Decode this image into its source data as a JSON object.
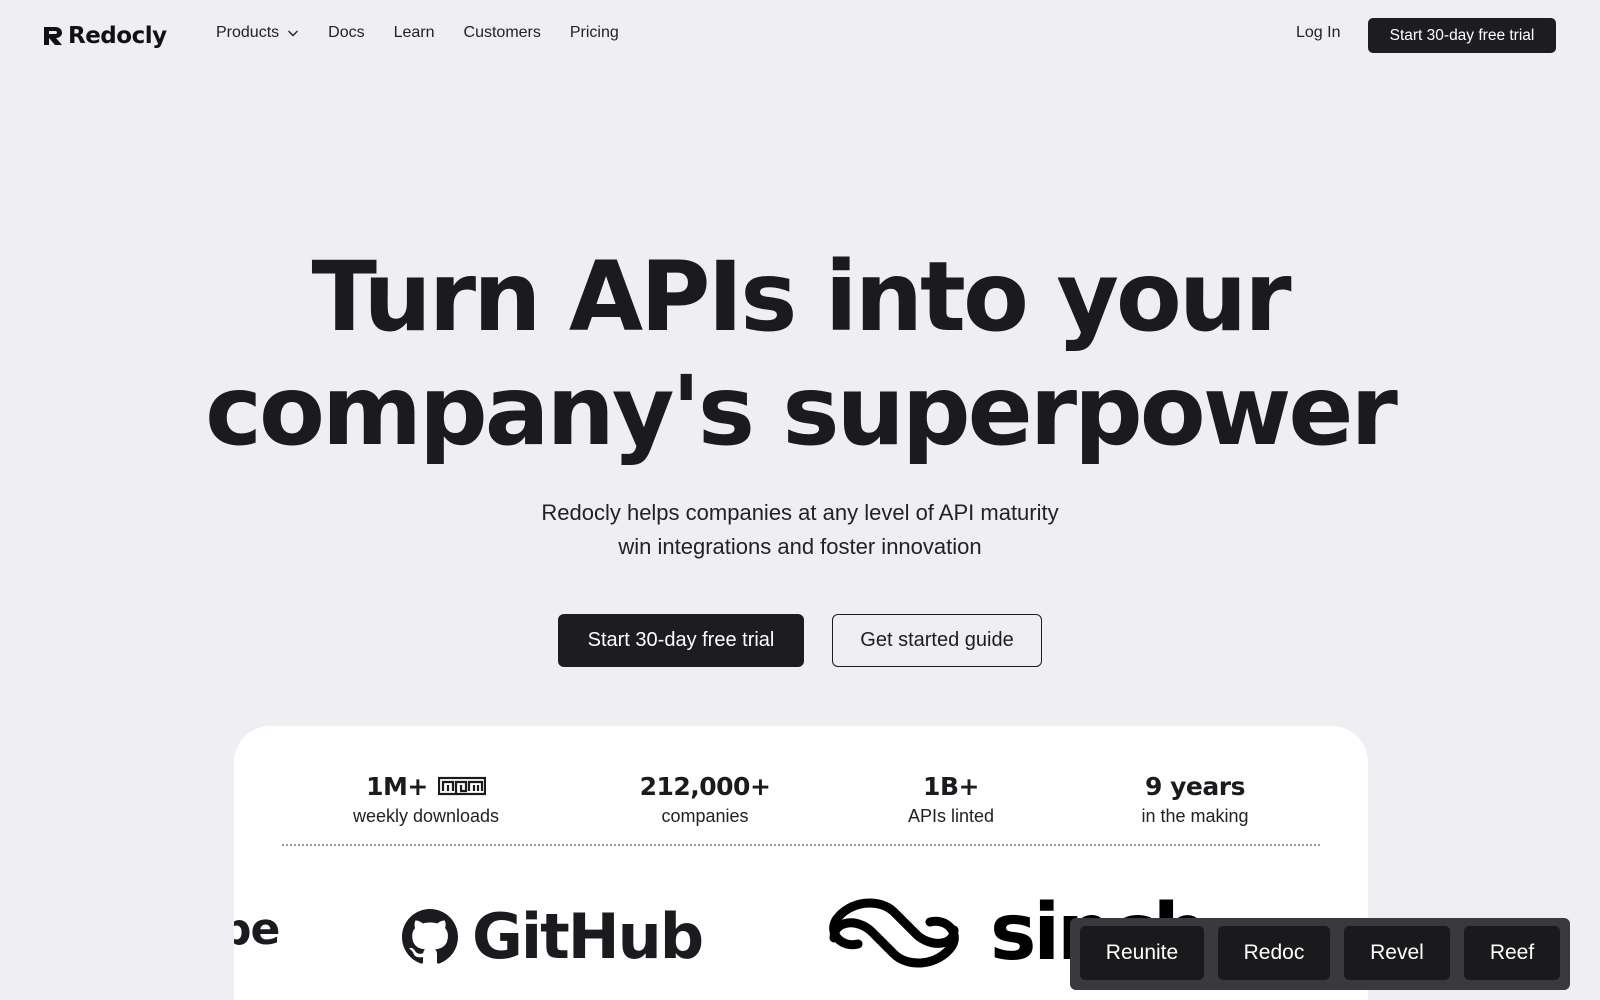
{
  "brand": {
    "name": "Redocly"
  },
  "nav": {
    "links": [
      {
        "label": "Products",
        "has_dropdown": true
      },
      {
        "label": "Docs"
      },
      {
        "label": "Learn"
      },
      {
        "label": "Customers"
      },
      {
        "label": "Pricing"
      }
    ],
    "login_label": "Log In",
    "cta_label": "Start 30-day free trial"
  },
  "hero": {
    "title_line1": "Turn APIs into your",
    "title_line2": "company's superpower",
    "subtitle_line1": "Redocly helps companies at any level of API maturity",
    "subtitle_line2": "win integrations and foster innovation",
    "primary_cta": "Start 30-day free trial",
    "secondary_cta": "Get started guide"
  },
  "stats": [
    {
      "value": "1M+",
      "label": "weekly downloads",
      "icon": "npm-icon"
    },
    {
      "value": "212,000+",
      "label": "companies"
    },
    {
      "value": "1B+",
      "label": "APIs linted"
    },
    {
      "value": "9 years",
      "label": "in the making"
    }
  ],
  "customer_logos": {
    "partial_left": "be",
    "github": "GitHub",
    "sinch": "sinch"
  },
  "product_bar": {
    "items": [
      "Reunite",
      "Redoc",
      "Revel",
      "Reef"
    ]
  },
  "colors": {
    "background": "#eeeef3",
    "dark": "#1d1d21",
    "card": "#ffffff",
    "product_bar": "#3a3a3e"
  }
}
